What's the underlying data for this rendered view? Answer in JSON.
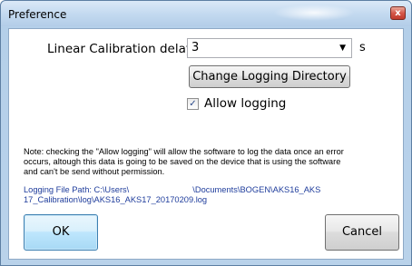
{
  "window": {
    "title": "Preference",
    "close_glyph": "x"
  },
  "form": {
    "delay_label": "Linear Calibration delay",
    "delay_value": "3",
    "delay_unit": "s",
    "change_dir_label": "Change Logging Directory",
    "allow_logging_label": "Allow logging",
    "allow_logging_checked": true
  },
  "note": {
    "line1": "Note: checking the \"Allow logging\" will allow the software to log the data once an error",
    "line2": "occurs, altough this data is going to be saved on the device that is using the software",
    "line3": " and can't be send without permission."
  },
  "logging_path": {
    "line1_a": "Logging File Path: C:\\Users\\",
    "line1_b": "\\Documents\\BOGEN\\AKS16_AKS",
    "line2": "17_Calibration\\log\\AKS16_AKS17_20170209.log"
  },
  "buttons": {
    "ok_label": "OK",
    "cancel_label": "Cancel"
  },
  "icons": {
    "dropdown": "chevron-down-icon",
    "check": "checkmark-icon",
    "close": "close-icon"
  }
}
